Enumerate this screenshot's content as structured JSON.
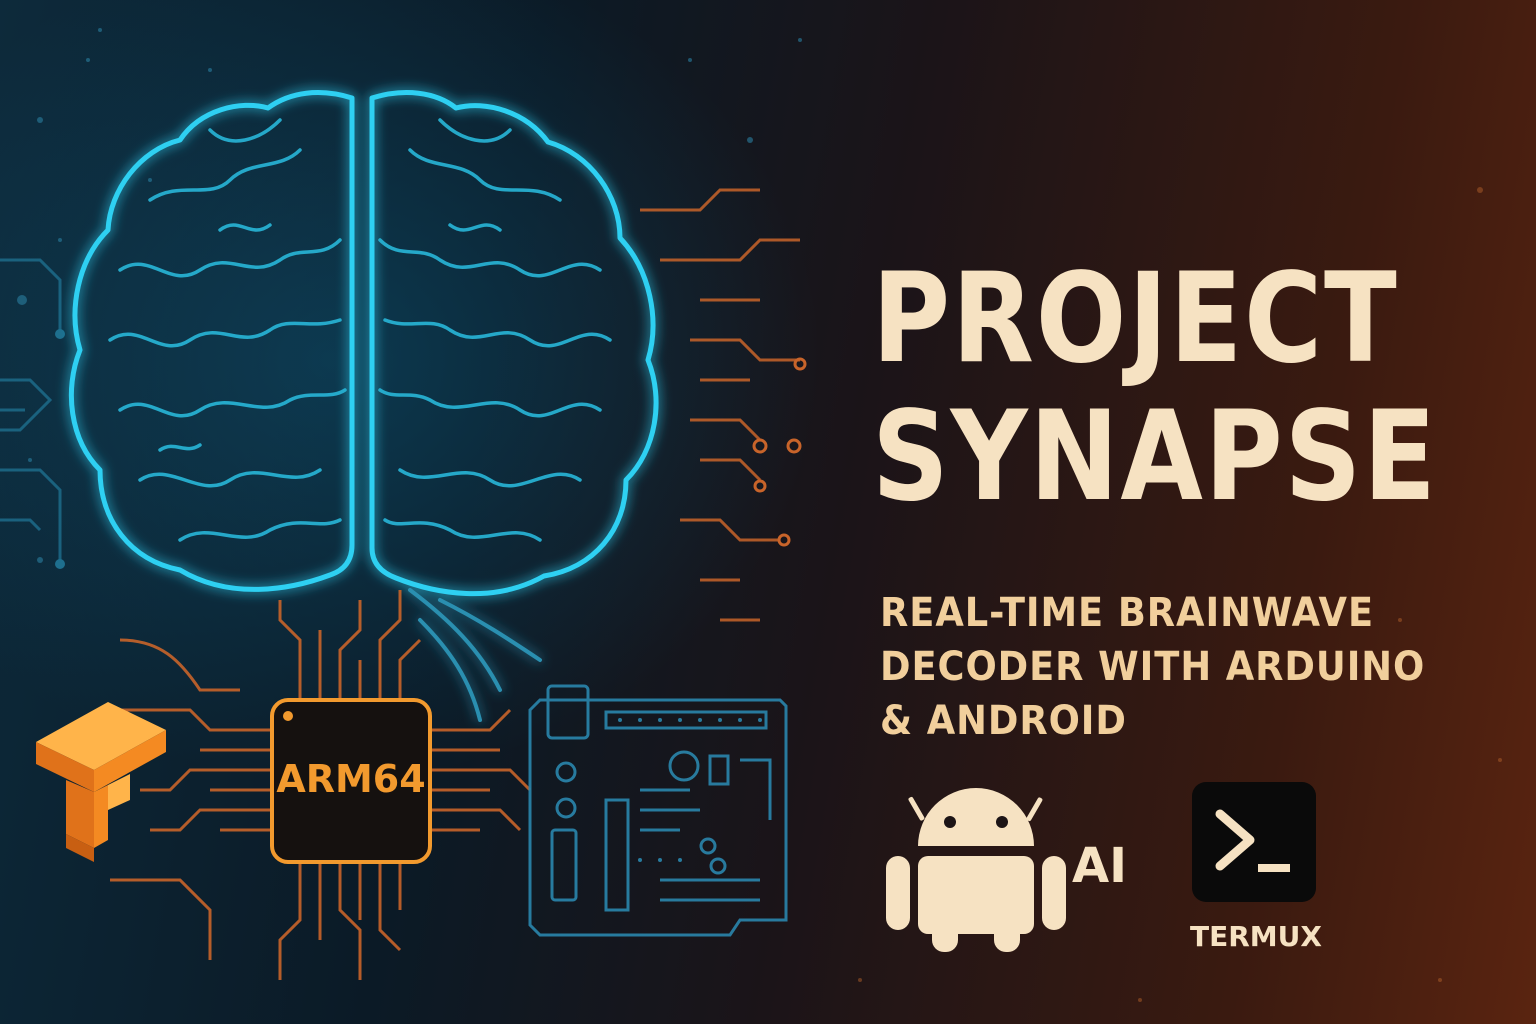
{
  "hero": {
    "title_line1": "PROJECT",
    "title_line2": "SYNAPSE",
    "subtitle_line1": "REAL-TIME BRAINWAVE",
    "subtitle_line2": "DECODER WITH ARDUINO",
    "subtitle_line3": "& ANDROID"
  },
  "illustration": {
    "chip_label": "ARM64",
    "icons": [
      "brain-icon",
      "tensorflow-icon",
      "arm64-chip-icon",
      "arduino-board-icon"
    ]
  },
  "badges": {
    "ai_label": "AI",
    "termux_label": "TERMUX",
    "icons": [
      "android-icon",
      "terminal-icon"
    ]
  },
  "colors": {
    "brain_glow": "#2fd0f2",
    "circuit_orange": "#c8642a",
    "chip_orange": "#f29a2e",
    "title_cream": "#f6e2c2",
    "subtitle_gold": "#f1cf9c",
    "tensorflow_orange": "#ff9a1f"
  }
}
